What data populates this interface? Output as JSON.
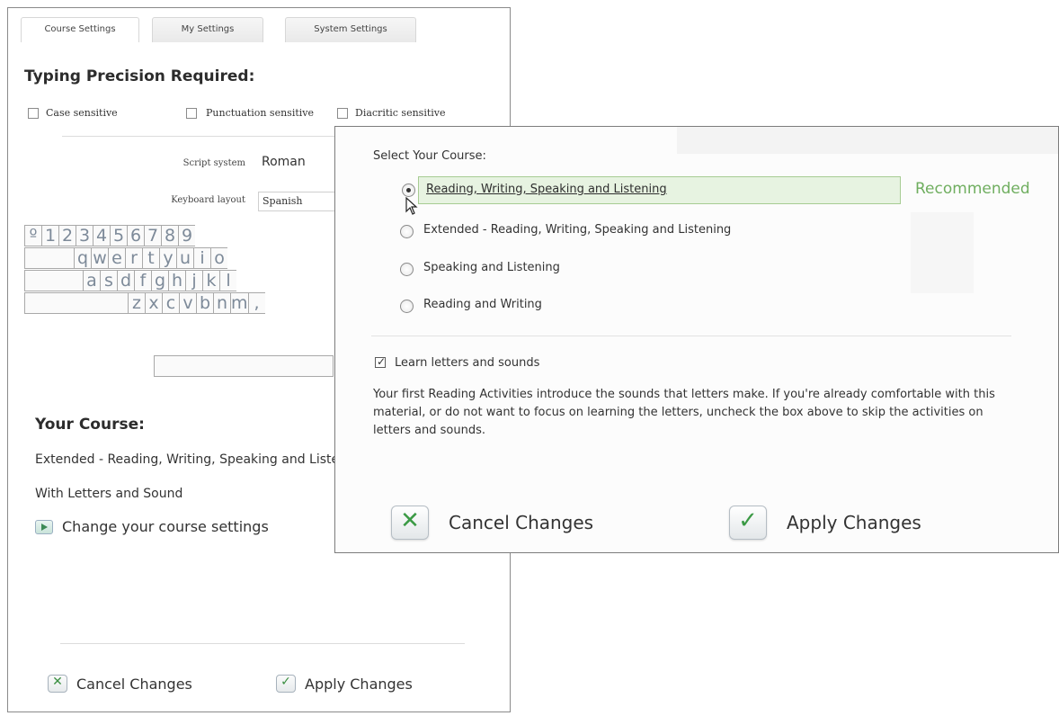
{
  "back_panel": {
    "tabs": [
      "Course Settings",
      "My Settings",
      "System Settings"
    ],
    "precision_title": "Typing Precision Required:",
    "checkboxes": [
      "Case sensitive",
      "Punctuation sensitive",
      "Diacritic sensitive"
    ],
    "script_system_label": "Script system",
    "script_system_value": "Roman",
    "keyboard_layout_label": "Keyboard layout",
    "keyboard_layout_value": "Spanish",
    "keyboard_rows": [
      [
        "º",
        "1",
        "2",
        "3",
        "4",
        "5",
        "6",
        "7",
        "8",
        "9"
      ],
      [
        "q",
        "w",
        "e",
        "r",
        "t",
        "y",
        "u",
        "i",
        "o"
      ],
      [
        "a",
        "s",
        "d",
        "f",
        "g",
        "h",
        "j",
        "k",
        "l"
      ],
      [
        "z",
        "x",
        "c",
        "v",
        "b",
        "n",
        "m",
        ","
      ]
    ],
    "your_course_title": "Your Course:",
    "course_line": "Extended - Reading, Writing, Speaking and Listening",
    "letters_line": "With Letters and Sound",
    "change_link": "Change your course settings",
    "cancel_label": "Cancel Changes",
    "apply_label": "Apply Changes"
  },
  "front_panel": {
    "heading": "Select Your Course:",
    "options": [
      "Reading, Writing, Speaking and Listening",
      "Extended - Reading, Writing, Speaking and Listening",
      "Speaking and Listening",
      "Reading and Writing"
    ],
    "selected_index": 0,
    "recommended": "Recommended",
    "checkbox_label": "Learn letters and sounds",
    "checkbox_checked": true,
    "description": "Your first Reading Activities introduce the sounds that letters make. If you're already comfortable with this material, or do not want to focus on learning the letters, uncheck the box above to skip the activities on letters and sounds.",
    "cancel_label": "Cancel Changes",
    "apply_label": "Apply Changes"
  }
}
